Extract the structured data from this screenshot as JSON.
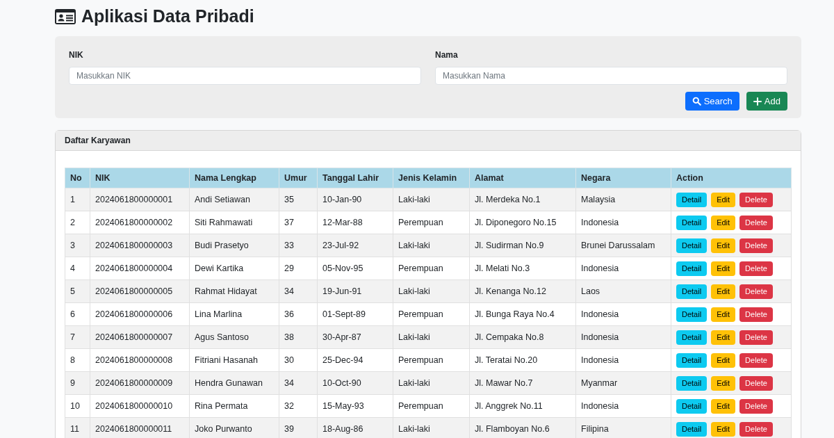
{
  "title": "Aplikasi Data Pribadi",
  "filters": [
    {
      "label": "NIK",
      "placeholder": "Masukkan NIK"
    },
    {
      "label": "Nama",
      "placeholder": "Masukkan Nama"
    }
  ],
  "buttons": [
    {
      "label": "Search",
      "kind": "search"
    },
    {
      "label": "Add",
      "kind": "add"
    }
  ],
  "table_card": {
    "title": "Daftar Karyawan",
    "columns": [
      "No",
      "NIK",
      "Nama Lengkap",
      "Umur",
      "Tanggal Lahir",
      "Jenis Kelamin",
      "Alamat",
      "Negara",
      "Action"
    ],
    "rows": [
      {
        "cells": [
          "1",
          "2024061800000001",
          "Andi Setiawan",
          "35",
          "10-Jan-90",
          "Laki-laki",
          "Jl. Merdeka No.1",
          "Malaysia"
        ],
        "actions": [
          "Detail",
          "Edit",
          "Delete"
        ]
      },
      {
        "cells": [
          "2",
          "2024061800000002",
          "Siti Rahmawati",
          "37",
          "12-Mar-88",
          "Perempuan",
          "Jl. Diponegoro No.15",
          "Indonesia"
        ],
        "actions": [
          "Detail",
          "Edit",
          "Delete"
        ]
      },
      {
        "cells": [
          "3",
          "2024061800000003",
          "Budi Prasetyo",
          "33",
          "23-Jul-92",
          "Laki-laki",
          "Jl. Sudirman No.9",
          "Brunei Darussalam"
        ],
        "actions": [
          "Detail",
          "Edit",
          "Delete"
        ]
      },
      {
        "cells": [
          "4",
          "2024061800000004",
          "Dewi Kartika",
          "29",
          "05-Nov-95",
          "Perempuan",
          "Jl. Melati No.3",
          "Indonesia"
        ],
        "actions": [
          "Detail",
          "Edit",
          "Delete"
        ]
      },
      {
        "cells": [
          "5",
          "2024061800000005",
          "Rahmat Hidayat",
          "34",
          "19-Jun-91",
          "Laki-laki",
          "Jl. Kenanga No.12",
          "Laos"
        ],
        "actions": [
          "Detail",
          "Edit",
          "Delete"
        ]
      },
      {
        "cells": [
          "6",
          "2024061800000006",
          "Lina Marlina",
          "36",
          "01-Sept-89",
          "Perempuan",
          "Jl. Bunga Raya No.4",
          "Indonesia"
        ],
        "actions": [
          "Detail",
          "Edit",
          "Delete"
        ]
      },
      {
        "cells": [
          "7",
          "2024061800000007",
          "Agus Santoso",
          "38",
          "30-Apr-87",
          "Laki-laki",
          "Jl. Cempaka No.8",
          "Indonesia"
        ],
        "actions": [
          "Detail",
          "Edit",
          "Delete"
        ]
      },
      {
        "cells": [
          "8",
          "2024061800000008",
          "Fitriani Hasanah",
          "30",
          "25-Dec-94",
          "Perempuan",
          "Jl. Teratai No.20",
          "Indonesia"
        ],
        "actions": [
          "Detail",
          "Edit",
          "Delete"
        ]
      },
      {
        "cells": [
          "9",
          "2024061800000009",
          "Hendra Gunawan",
          "34",
          "10-Oct-90",
          "Laki-laki",
          "Jl. Mawar No.7",
          "Myanmar"
        ],
        "actions": [
          "Detail",
          "Edit",
          "Delete"
        ]
      },
      {
        "cells": [
          "10",
          "2024061800000010",
          "Rina Permata",
          "32",
          "15-May-93",
          "Perempuan",
          "Jl. Anggrek No.11",
          "Indonesia"
        ],
        "actions": [
          "Detail",
          "Edit",
          "Delete"
        ]
      },
      {
        "cells": [
          "11",
          "2024061800000011",
          "Joko Purwanto",
          "39",
          "18-Aug-86",
          "Laki-laki",
          "Jl. Flamboyan No.6",
          "Filipina"
        ],
        "actions": [
          "Detail",
          "Edit",
          "Delete"
        ]
      }
    ]
  }
}
